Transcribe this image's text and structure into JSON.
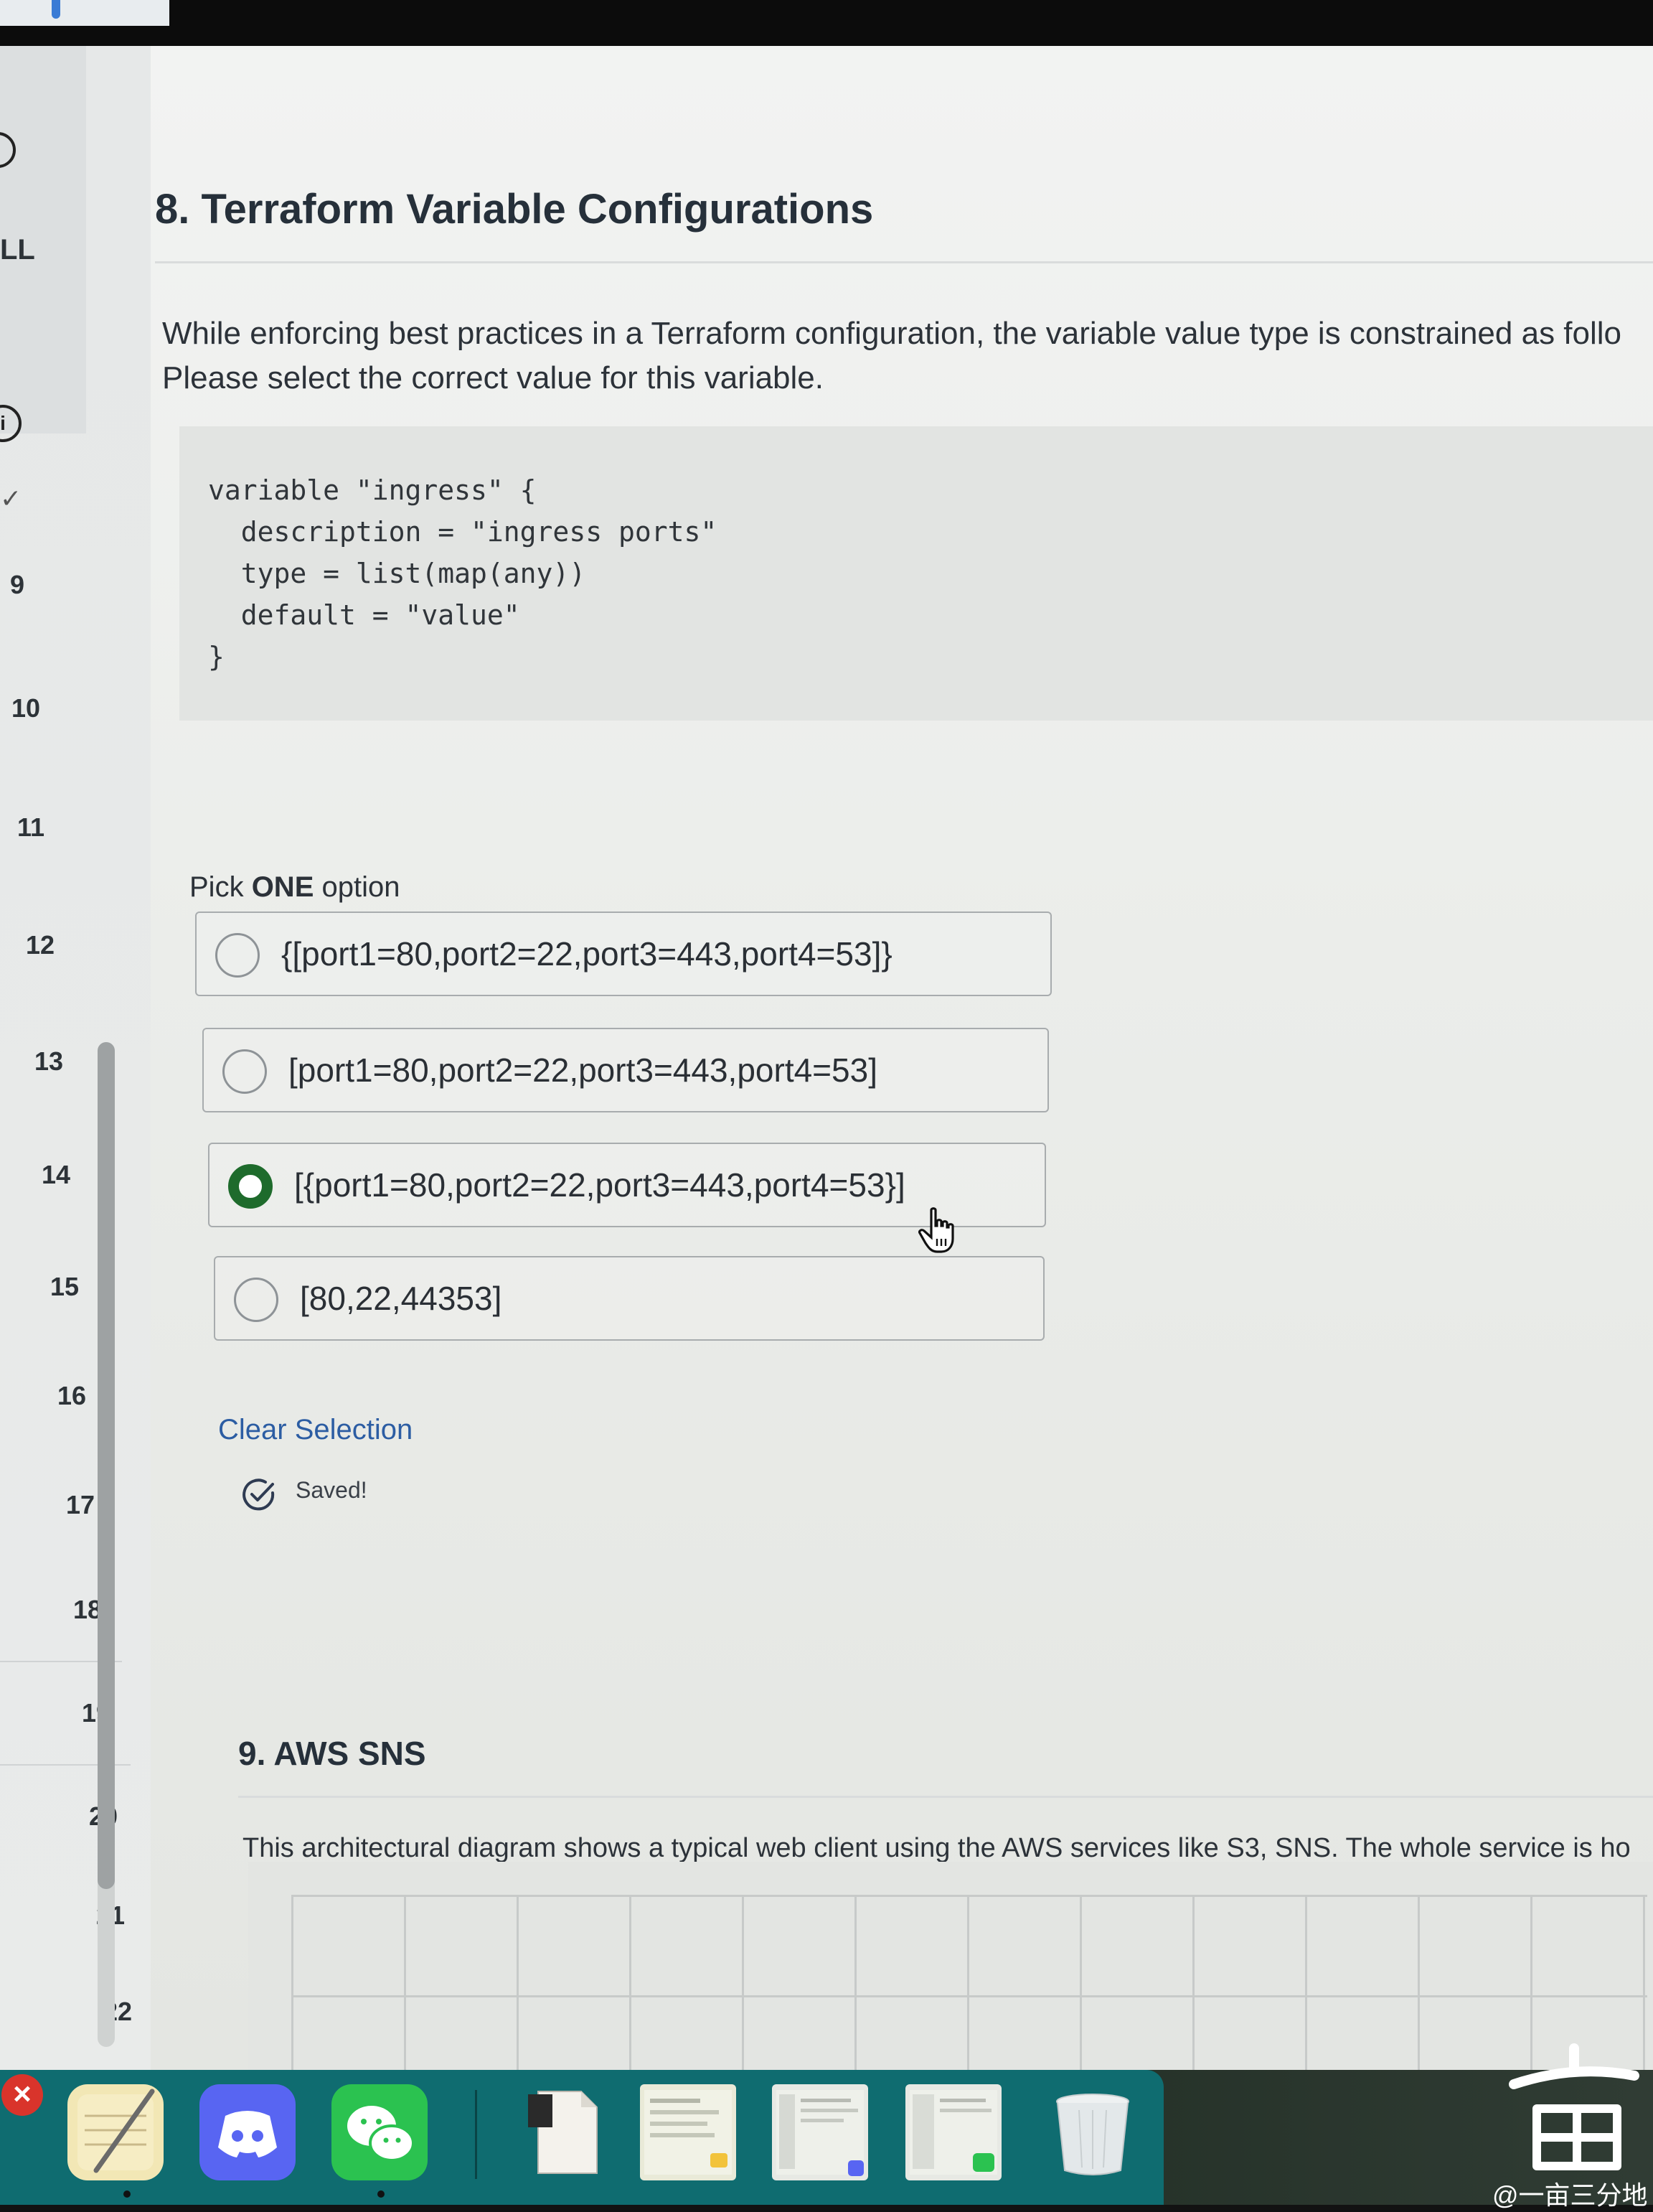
{
  "sidebar": {
    "partial_label": "LL",
    "question_numbers": [
      "9",
      "10",
      "11",
      "12",
      "13",
      "14",
      "15",
      "16",
      "17",
      "18",
      "19",
      "20",
      "21",
      "22"
    ]
  },
  "question8": {
    "title": "8. Terraform Variable Configurations",
    "text_line1": "While enforcing best practices in a Terraform configuration, the variable value type is constrained as follo",
    "text_line2": "Please select the correct value for this variable.",
    "code": "variable \"ingress\" {\n  description = \"ingress ports\"\n  type = list(map(any))\n  default = \"value\"\n}",
    "pick_prefix": "Pick ",
    "pick_bold": "ONE",
    "pick_suffix": " option",
    "options": [
      {
        "label": "{[port1=80,port2=22,port3=443,port4=53]}",
        "selected": false
      },
      {
        "label": "[port1=80,port2=22,port3=443,port4=53]",
        "selected": false
      },
      {
        "label": "[{port1=80,port2=22,port3=443,port4=53}]",
        "selected": true
      },
      {
        "label": "[80,22,44353]",
        "selected": false
      }
    ],
    "clear_selection": "Clear Selection",
    "saved_status": "Saved!"
  },
  "question9": {
    "title": "9. AWS SNS",
    "text": "This architectural diagram shows a typical web client using the AWS services like S3, SNS. The whole service is ho"
  },
  "dock": {
    "apps": [
      "textedit-icon",
      "discord-icon",
      "wechat-icon",
      "document-icon",
      "notes-window-icon",
      "discord-window-icon",
      "wechat-window-icon",
      "trash-icon"
    ]
  },
  "watermark": {
    "text": "@一亩三分地"
  },
  "colors": {
    "selected_radio": "#1e6b2c",
    "link": "#2c5da3",
    "dock": "#0f6c70",
    "discord": "#5865f2",
    "wechat": "#2bc250"
  }
}
